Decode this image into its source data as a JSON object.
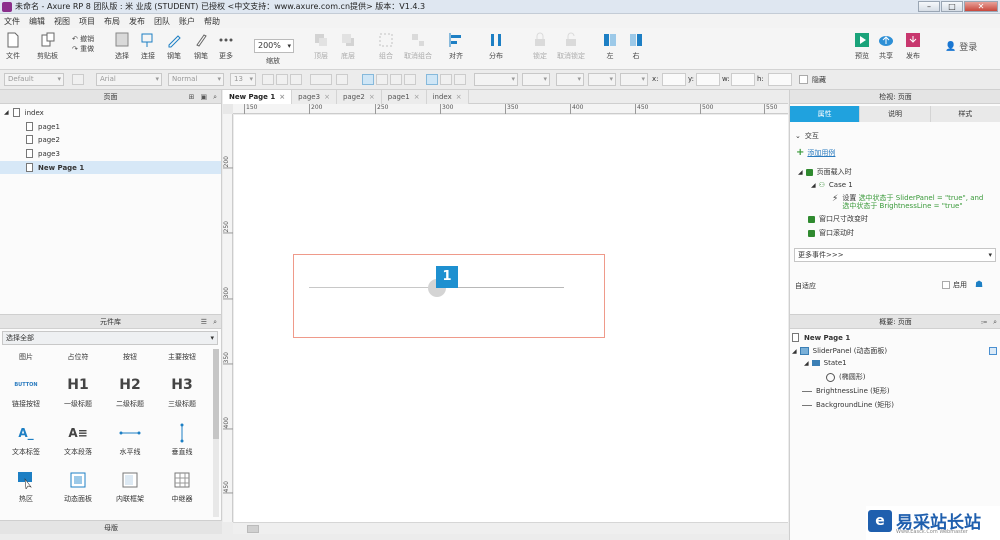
{
  "titlebar": {
    "title": "未命名 - Axure RP 8 团队版 : 米 业成 (STUDENT) 已授权    <中文支持：www.axure.com.cn提供> 版本：V1.4.3"
  },
  "menu": [
    "文件",
    "编辑",
    "视图",
    "项目",
    "布局",
    "发布",
    "团队",
    "账户",
    "帮助"
  ],
  "toolbar": {
    "file": "文件",
    "clipboard": "剪贴板",
    "undo": "撤销",
    "redo": "重做",
    "select": "选择",
    "connect": "连接",
    "pen": "钢笔",
    "more": "更多",
    "zoom_value": "200%",
    "zoom_label": "缩放",
    "top": "顶层",
    "bottom": "底层",
    "group": "组合",
    "ungroup": "取消组合",
    "align": "对齐",
    "distribute": "分布",
    "lock": "锁定",
    "unlock": "取消锁定",
    "left": "左",
    "right": "右",
    "preview": "预览",
    "share": "共享",
    "publish": "发布",
    "login": "登录"
  },
  "formatbar": {
    "style": "Default",
    "font": "Arial",
    "weight": "Normal",
    "size": "13",
    "x_label": "x:",
    "y_label": "y:",
    "w_label": "w:",
    "h_label": "h:",
    "hidden_label": "隐藏"
  },
  "pages": {
    "title": "页面",
    "root": "index",
    "items": [
      "page1",
      "page2",
      "page3",
      "New Page 1"
    ],
    "selected": "New Page 1"
  },
  "library": {
    "title": "元件库",
    "selector": "选择全部",
    "top_row": [
      "图片",
      "占位符",
      "按钮",
      "主要按钮"
    ],
    "widgets": [
      {
        "icon_text": "BUTTON",
        "label": "链接按钮"
      },
      {
        "icon_text": "H1",
        "label": "一级标题"
      },
      {
        "icon_text": "H2",
        "label": "二级标题"
      },
      {
        "icon_text": "H3",
        "label": "三级标题"
      },
      {
        "icon_text": "A_",
        "label": "文本标签"
      },
      {
        "icon_text": "A≡",
        "label": "文本段落"
      },
      {
        "icon_text": "",
        "label": "水平线"
      },
      {
        "icon_text": "",
        "label": "垂直线"
      },
      {
        "icon_text": "",
        "label": "热区"
      },
      {
        "icon_text": "",
        "label": "动态面板"
      },
      {
        "icon_text": "",
        "label": "内联框架"
      },
      {
        "icon_text": "",
        "label": "中继器"
      }
    ],
    "masters_title": "母版"
  },
  "tabs": [
    "New Page 1",
    "page3",
    "page2",
    "page1",
    "index"
  ],
  "ruler": {
    "top": [
      "150",
      "200",
      "250",
      "300",
      "350",
      "400",
      "450",
      "500",
      "550"
    ],
    "left": [
      "200",
      "250",
      "300",
      "350",
      "400",
      "450"
    ]
  },
  "canvas": {
    "marker_number": "1"
  },
  "inspector": {
    "title": "检视: 页面",
    "tabs": [
      "属性",
      "说明",
      "样式"
    ],
    "section": "交互",
    "add_case": "添加用例",
    "event_load": "页面载入时",
    "case": "Case 1",
    "action_label": "设置",
    "action_text_1": "选中状态于 SliderPanel = \"true\", and",
    "action_text_2": "选中状态于 BrightnessLine = \"true\"",
    "event_resize": "窗口尺寸改变时",
    "event_scroll": "窗口滚动时",
    "more_events": "更多事件>>>",
    "adaptive": "自适应",
    "enable": "启用"
  },
  "outline": {
    "title": "概要: 页面",
    "page": "New Page 1",
    "items": [
      "SliderPanel (动态面板)",
      "State1",
      "(椭圆形)",
      "BrightnessLine (矩形)",
      "BackgroundLine (矩形)"
    ]
  },
  "watermark": {
    "text": "易采站长站",
    "sub": "Www.Easck.Com  Webmaster"
  }
}
